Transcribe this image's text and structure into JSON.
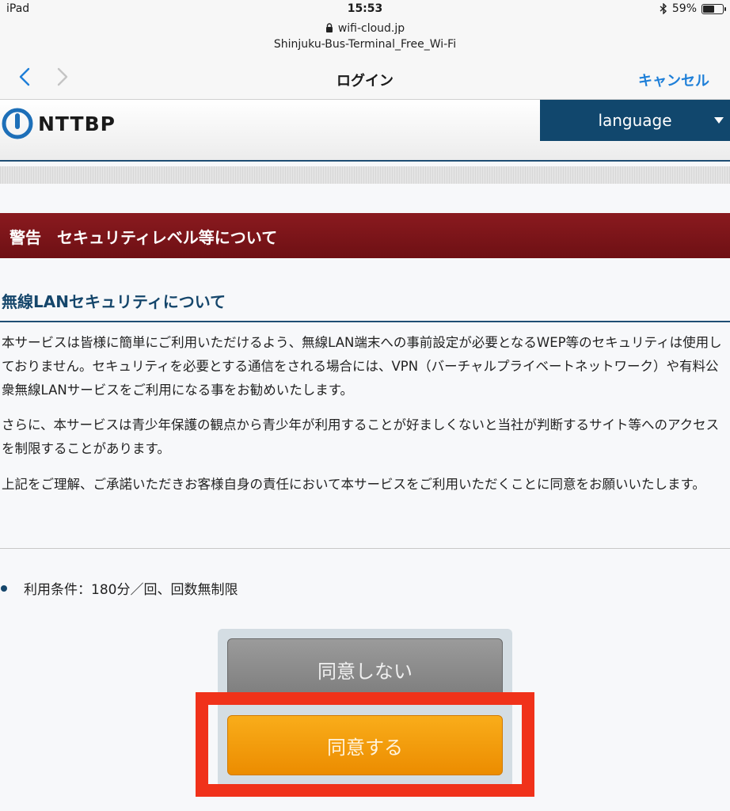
{
  "status_bar": {
    "device": "iPad",
    "time": "15:53",
    "bluetooth_icon": "bluetooth-icon",
    "battery_percent": "59%",
    "battery_level": 0.59
  },
  "browser": {
    "url": "wifi-cloud.jp",
    "ssid": "Shinjuku-Bus-Terminal_Free_Wi-Fi",
    "title": "ログイン",
    "cancel_label": "キャンセル"
  },
  "header": {
    "logo_text": "NTTBP",
    "language_label": "language"
  },
  "warning": {
    "title": "警告　セキュリティレベル等について"
  },
  "section": {
    "title": "無線LANセキュリティについて",
    "paragraphs": [
      "本サービスは皆様に簡単にご利用いただけるよう、無線LAN端末への事前設定が必要となるWEP等のセキュリティは使用しておりません。セキュリティを必要とする通信をされる場合には、VPN（バーチャルプライベートネットワーク）や有料公衆無線LANサービスをご利用になる事をお勧めいたします。",
      "さらに、本サービスは青少年保護の観点から青少年が利用することが好ましくないと当社が判断するサイト等へのアクセスを制限することがあります。",
      "上記をご理解、ご承諾いただきお客様自身の責任において本サービスをご利用いただくことに同意をお願いいたします。"
    ]
  },
  "terms": {
    "label": "利用条件：180分／回、回数無制限"
  },
  "buttons": {
    "disagree": "同意しない",
    "agree": "同意する"
  },
  "colors": {
    "brand_navy": "#11476d",
    "warning_red": "#7a1418",
    "agree_orange": "#f29d0c",
    "highlight_red": "#f0321a",
    "link_blue": "#1e7fd8"
  }
}
